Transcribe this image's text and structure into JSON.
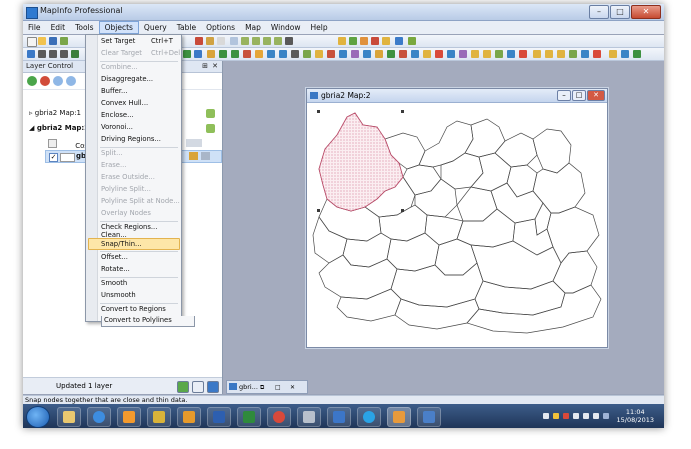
{
  "app": {
    "title": "MapInfo Professional"
  },
  "menubar": [
    "File",
    "Edit",
    "Tools",
    "Objects",
    "Query",
    "Table",
    "Options",
    "Map",
    "Window",
    "Help"
  ],
  "layer_control": {
    "title": "Layer Control",
    "maps": [
      {
        "label": "gbria2 Map:1"
      },
      {
        "label": "gbria2 Map:2"
      }
    ],
    "layers": [
      {
        "label": "Cos"
      },
      {
        "label": "gbr"
      }
    ],
    "footer": "Updated 1 layer"
  },
  "objects_menu": [
    {
      "label": "Set Target",
      "shortcut": "Ctrl+T",
      "enabled": true
    },
    {
      "label": "Clear Target",
      "shortcut": "Ctrl+Del",
      "enabled": false
    },
    {
      "label": "Combine...",
      "enabled": false
    },
    {
      "label": "Disaggregate...",
      "enabled": true
    },
    {
      "label": "Buffer...",
      "enabled": true
    },
    {
      "label": "Convex Hull...",
      "enabled": true
    },
    {
      "label": "Enclose...",
      "enabled": true
    },
    {
      "label": "Voronoi...",
      "enabled": true
    },
    {
      "label": "Driving Regions...",
      "enabled": true
    },
    {
      "label": "Split...",
      "enabled": false
    },
    {
      "label": "Erase...",
      "enabled": false
    },
    {
      "label": "Erase Outside...",
      "enabled": false
    },
    {
      "label": "Polyline Split...",
      "enabled": false
    },
    {
      "label": "Polyline Split at Node...",
      "enabled": false
    },
    {
      "label": "Overlay Nodes",
      "enabled": false
    },
    {
      "label": "Check Regions...",
      "enabled": true
    },
    {
      "label": "Clean...",
      "enabled": true
    },
    {
      "label": "Snap/Thin...",
      "enabled": true,
      "highlighted": true
    },
    {
      "label": "Offset...",
      "enabled": true
    },
    {
      "label": "Rotate...",
      "enabled": true
    },
    {
      "label": "Smooth",
      "enabled": true
    },
    {
      "label": "Unsmooth",
      "enabled": true
    },
    {
      "label": "Convert to Regions",
      "enabled": true
    },
    {
      "label": "Convert to Polylines",
      "enabled": true
    }
  ],
  "map_window": {
    "title": "gbria2 Map:2"
  },
  "minimized_window": {
    "label": "gbri..."
  },
  "statusbar": "Snap nodes together that are close and thin data.",
  "taskbar": {
    "time": "11:04",
    "date": "15/08/2013"
  },
  "colors": {
    "selection_fill": "#e8a4b4",
    "accent": "#fde6a8"
  }
}
